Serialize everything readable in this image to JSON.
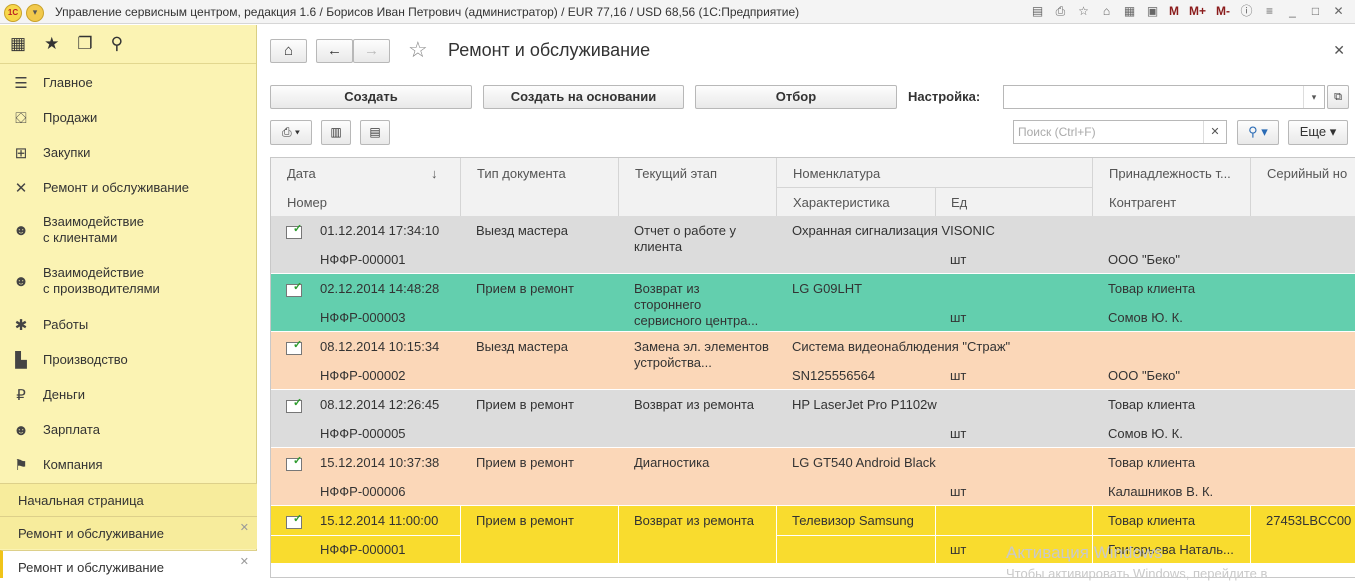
{
  "window": {
    "title": "Управление сервисным центром, редакция 1.6 / Борисов Иван Петрович (администратор) / EUR 77,16 / USD 68,56  (1С:Предприятие)",
    "logo": "1С",
    "icons": [
      "save-icon",
      "print-icon",
      "star-icon",
      "home-icon",
      "calc-icon",
      "calendar-icon"
    ],
    "mem": [
      "M",
      "M+",
      "M-"
    ]
  },
  "sidebar": {
    "items": [
      {
        "label": "Главное",
        "icon": "menu-icon"
      },
      {
        "label": "Продажи",
        "icon": "basket-icon"
      },
      {
        "label": "Закупки",
        "icon": "cart-icon"
      },
      {
        "label": "Ремонт и обслуживание",
        "icon": "tools-icon"
      },
      {
        "label": "Взаимодействие\nс клиентами",
        "icon": "clients-icon"
      },
      {
        "label": "Взаимодействие\nс производителями",
        "icon": "vendors-icon"
      },
      {
        "label": "Работы",
        "icon": "works-icon"
      },
      {
        "label": "Производство",
        "icon": "factory-icon"
      },
      {
        "label": "Деньги",
        "icon": "money-icon"
      },
      {
        "label": "Зарплата",
        "icon": "salary-icon"
      },
      {
        "label": "Компания",
        "icon": "flag-icon"
      }
    ],
    "tabs": [
      {
        "label": "Начальная страница"
      },
      {
        "label": "Ремонт и обслуживание"
      },
      {
        "label": "Ремонт и обслуживание"
      }
    ]
  },
  "main": {
    "title": "Ремонт и обслуживание",
    "buttons": {
      "create": "Создать",
      "create_based": "Создать на основании",
      "filter": "Отбор",
      "more": "Еще"
    },
    "settings_label": "Настройка:",
    "search_placeholder": "Поиск (Ctrl+F)",
    "columns": {
      "date": "Дата",
      "number": "Номер",
      "doc_type": "Тип документа",
      "stage": "Текущий этап",
      "nomenclature": "Номенклатура",
      "characteristic": "Характеристика",
      "unit": "Ед",
      "belongs": "Принадлежность т...",
      "counterparty": "Контрагент",
      "serial": "Серийный но"
    },
    "rows": [
      {
        "date": "01.12.2014 17:34:10",
        "number": "НФФР-000001",
        "type": "Выезд мастера",
        "stage": "Отчет о работе у клиента",
        "nom": "Охранная сигнализация VISONIC",
        "char": "",
        "unit": "шт",
        "belongs": "",
        "counterparty": "ООО \"Беко\"",
        "serial": "",
        "color": "#dcdcdc"
      },
      {
        "date": "02.12.2014 14:48:28",
        "number": "НФФР-000003",
        "type": "Прием в ремонт",
        "stage": "Возврат из стороннего сервисного центра...",
        "nom": "LG G09LHT",
        "char": "",
        "unit": "шт",
        "belongs": "Товар клиента",
        "counterparty": "Сомов Ю. К.",
        "serial": "",
        "color": "#63cfae"
      },
      {
        "date": "08.12.2014 10:15:34",
        "number": "НФФР-000002",
        "type": "Выезд мастера",
        "stage": "Замена эл. элементов устройства...",
        "nom": "Система видеонаблюдения \"Страж\"",
        "char": "SN125556564",
        "unit": "шт",
        "belongs": "",
        "counterparty": "ООО \"Беко\"",
        "serial": "",
        "color": "#fbd7b8"
      },
      {
        "date": "08.12.2014 12:26:45",
        "number": "НФФР-000005",
        "type": "Прием в ремонт",
        "stage": "Возврат из ремонта",
        "nom": "HP LaserJet Pro P1102w",
        "char": "",
        "unit": "шт",
        "belongs": "Товар клиента",
        "counterparty": "Сомов Ю. К.",
        "serial": "",
        "color": "#dcdcdc"
      },
      {
        "date": "15.12.2014 10:37:38",
        "number": "НФФР-000006",
        "type": "Прием в ремонт",
        "stage": "Диагностика",
        "nom": "LG GT540 Android Black",
        "char": "",
        "unit": "шт",
        "belongs": "Товар клиента",
        "counterparty": "Калашников В. К.",
        "serial": "",
        "color": "#fbd7b8"
      },
      {
        "date": "15.12.2014 11:00:00",
        "number": "НФФР-000001",
        "type": "Прием в ремонт",
        "stage": "Возврат из ремонта",
        "nom": "Телевизор Samsung",
        "char": "",
        "unit": "шт",
        "belongs": "Товар клиента",
        "counterparty": "Григорьева Наталь...",
        "serial": "27453LBCC00",
        "color": "#f9dc2e"
      }
    ]
  },
  "watermark": {
    "line1": "Активация Windows",
    "line2": "Чтобы активировать Windows, перейдите в"
  }
}
